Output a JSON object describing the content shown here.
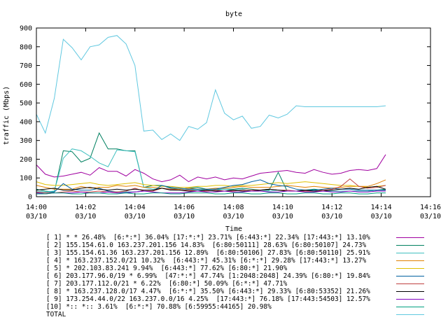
{
  "chart_data": {
    "type": "line",
    "title": "byte",
    "xlabel": "Time",
    "ylabel": "traffic (Mbps)",
    "ylim": [
      0,
      900
    ],
    "yticks": [
      0,
      100,
      200,
      300,
      400,
      500,
      600,
      700,
      800,
      900
    ],
    "xlim": [
      0,
      140
    ],
    "xticks": [
      {
        "t": 0,
        "time": "14:00",
        "date": "03/10"
      },
      {
        "t": 20,
        "time": "14:02",
        "date": "03/10"
      },
      {
        "t": 40,
        "time": "14:04",
        "date": "03/10"
      },
      {
        "t": 60,
        "time": "14:06",
        "date": "03/10"
      },
      {
        "t": 80,
        "time": "14:08",
        "date": "03/10"
      },
      {
        "t": 100,
        "time": "14:10",
        "date": "03/10"
      },
      {
        "t": 120,
        "time": "14:12",
        "date": "03/10"
      },
      {
        "t": 140,
        "time": "14:14",
        "date": "03/10"
      },
      {
        "t": 160,
        "time": "14:16",
        "date": "03/10"
      }
    ],
    "grid": false,
    "legend_position": "bottom",
    "x": [
      0,
      3.64,
      7.27,
      10.9,
      14.5,
      18.2,
      21.8,
      25.5,
      29.1,
      32.7,
      36.4,
      40,
      43.6,
      47.3,
      50.9,
      54.5,
      58.2,
      61.8,
      65.5,
      69.1,
      72.7,
      76.4,
      80,
      83.6,
      87.3,
      90.9,
      94.5,
      98.2,
      101.8,
      105.5,
      109.1,
      112.7,
      116.4,
      120,
      123.6,
      127.3,
      130.9,
      134.5,
      138.2,
      141.8
    ],
    "series": [
      {
        "name": "[ 1] * * 26.48%  [6:*:*] 36.04% [17:*:*] 23.71% [6:443:*] 22.34% [17:443:*] 13.10%",
        "color": "#a000a0",
        "values": [
          170,
          120,
          105,
          110,
          120,
          130,
          115,
          155,
          135,
          135,
          110,
          145,
          125,
          95,
          80,
          90,
          115,
          80,
          105,
          95,
          105,
          90,
          100,
          95,
          110,
          125,
          130,
          135,
          140,
          130,
          125,
          145,
          130,
          120,
          125,
          140,
          145,
          140,
          150,
          225
        ]
      },
      {
        "name": "[ 2] 155.154.61.0 163.237.201.156 14.83%  [6:80:50111] 28.63% [6:80:50107] 24.73%",
        "color": "#008060",
        "values": [
          40,
          30,
          25,
          245,
          240,
          185,
          205,
          340,
          255,
          255,
          245,
          245,
          50,
          60,
          60,
          45,
          40,
          45,
          50,
          40,
          40,
          40,
          40,
          45,
          40,
          35,
          35,
          130,
          30,
          30,
          35,
          40,
          35,
          30,
          30,
          30,
          30,
          30,
          35,
          40
        ]
      },
      {
        "name": "[ 3] 155.154.61.36 163.237.201.156 12.89%  [6:80:50106] 27.83% [6:80:50110] 25.91%",
        "color": "#40c0c0",
        "values": [
          30,
          25,
          30,
          205,
          255,
          245,
          215,
          180,
          160,
          250,
          245,
          240,
          50,
          40,
          45,
          40,
          35,
          40,
          35,
          35,
          35,
          40,
          35,
          40,
          30,
          30,
          30,
          35,
          30,
          30,
          30,
          35,
          30,
          30,
          30,
          30,
          30,
          30,
          35,
          35
        ]
      },
      {
        "name": "[ 4] * 163.237.152.0/21 10.32%  [6:443:*] 45.31% [6:*:*] 29.28% [17:443:*] 13.27%",
        "color": "#e08000",
        "values": [
          60,
          50,
          40,
          40,
          40,
          55,
          45,
          50,
          50,
          60,
          55,
          60,
          50,
          50,
          45,
          40,
          40,
          45,
          40,
          40,
          45,
          45,
          50,
          55,
          50,
          50,
          50,
          55,
          60,
          55,
          50,
          55,
          50,
          45,
          50,
          55,
          55,
          55,
          70,
          90
        ]
      },
      {
        "name": "[ 5] * 202.103.83.241 9.94%  [6:443:*] 77.62% [6:80:*] 21.90%",
        "color": "#e0c000",
        "values": [
          80,
          65,
          60,
          60,
          65,
          70,
          75,
          65,
          60,
          65,
          70,
          75,
          65,
          60,
          55,
          55,
          50,
          50,
          55,
          55,
          60,
          60,
          55,
          60,
          60,
          65,
          70,
          75,
          70,
          75,
          80,
          75,
          70,
          65,
          60,
          60,
          55,
          50,
          55,
          60
        ]
      },
      {
        "name": "[ 6] 203.177.96.0/19 * 6.99%  [47:*:*] 47.74% [1:2048:2048] 24.39% [6:80:*] 19.84%",
        "color": "#0060a0",
        "values": [
          20,
          20,
          25,
          70,
          40,
          35,
          35,
          45,
          30,
          25,
          25,
          25,
          30,
          30,
          60,
          50,
          45,
          40,
          40,
          40,
          40,
          50,
          60,
          65,
          80,
          90,
          70,
          60,
          55,
          40,
          35,
          35,
          40,
          45,
          40,
          40,
          35,
          35,
          35,
          35
        ]
      },
      {
        "name": "[ 7] 203.177.112.0/21 * 6.22%  [6:80:*] 50.09% [6:*:*] 47.71%",
        "color": "#c04040",
        "values": [
          25,
          20,
          20,
          25,
          30,
          25,
          25,
          30,
          25,
          25,
          30,
          45,
          30,
          30,
          45,
          40,
          35,
          35,
          30,
          30,
          35,
          30,
          30,
          35,
          35,
          35,
          40,
          35,
          35,
          30,
          30,
          30,
          35,
          40,
          55,
          95,
          55,
          45,
          50,
          60
        ]
      },
      {
        "name": "[ 8] * 163.237.128.0/17 4.47%  [6:*:*] 35.50% [6:443:*] 29.33% [6:80:53352] 21.26%",
        "color": "#000000",
        "values": [
          35,
          40,
          45,
          35,
          35,
          45,
          50,
          40,
          35,
          40,
          35,
          40,
          35,
          35,
          45,
          35,
          35,
          30,
          30,
          35,
          30,
          30,
          35,
          30,
          30,
          35,
          40,
          35,
          30,
          30,
          35,
          30,
          30,
          35,
          40,
          45,
          40,
          50,
          55,
          40
        ]
      },
      {
        "name": "[ 9] 173.254.44.0/22 163.237.0.0/16 4.25%  [17:443:*] 76.18% [17:443:54503] 12.57%",
        "color": "#8000c0",
        "values": [
          20,
          15,
          20,
          20,
          20,
          25,
          20,
          20,
          25,
          20,
          20,
          25,
          30,
          25,
          20,
          20,
          20,
          25,
          30,
          25,
          25,
          30,
          25,
          25,
          30,
          30,
          25,
          25,
          30,
          30,
          25,
          25,
          30,
          25,
          25,
          30,
          25,
          25,
          30,
          30
        ]
      },
      {
        "name": "[10] *:: *:: 3.61%  [6:*:*] 70.88% [6:59955:44165] 20.98%",
        "color": "#00a080",
        "values": [
          15,
          15,
          20,
          20,
          15,
          15,
          20,
          20,
          15,
          15,
          20,
          15,
          15,
          20,
          20,
          15,
          15,
          20,
          20,
          20,
          15,
          15,
          20,
          20,
          15,
          15,
          20,
          20,
          15,
          15,
          20,
          20,
          15,
          15,
          20,
          20,
          15,
          15,
          20,
          20
        ]
      },
      {
        "name": "TOTAL",
        "color": "#60c8e0",
        "values": [
          440,
          340,
          525,
          840,
          795,
          730,
          800,
          810,
          850,
          860,
          815,
          700,
          350,
          355,
          305,
          335,
          300,
          375,
          360,
          395,
          570,
          445,
          410,
          430,
          365,
          375,
          435,
          420,
          440,
          485,
          480,
          480,
          480,
          480,
          480,
          480,
          480,
          480,
          480,
          485
        ]
      }
    ]
  }
}
